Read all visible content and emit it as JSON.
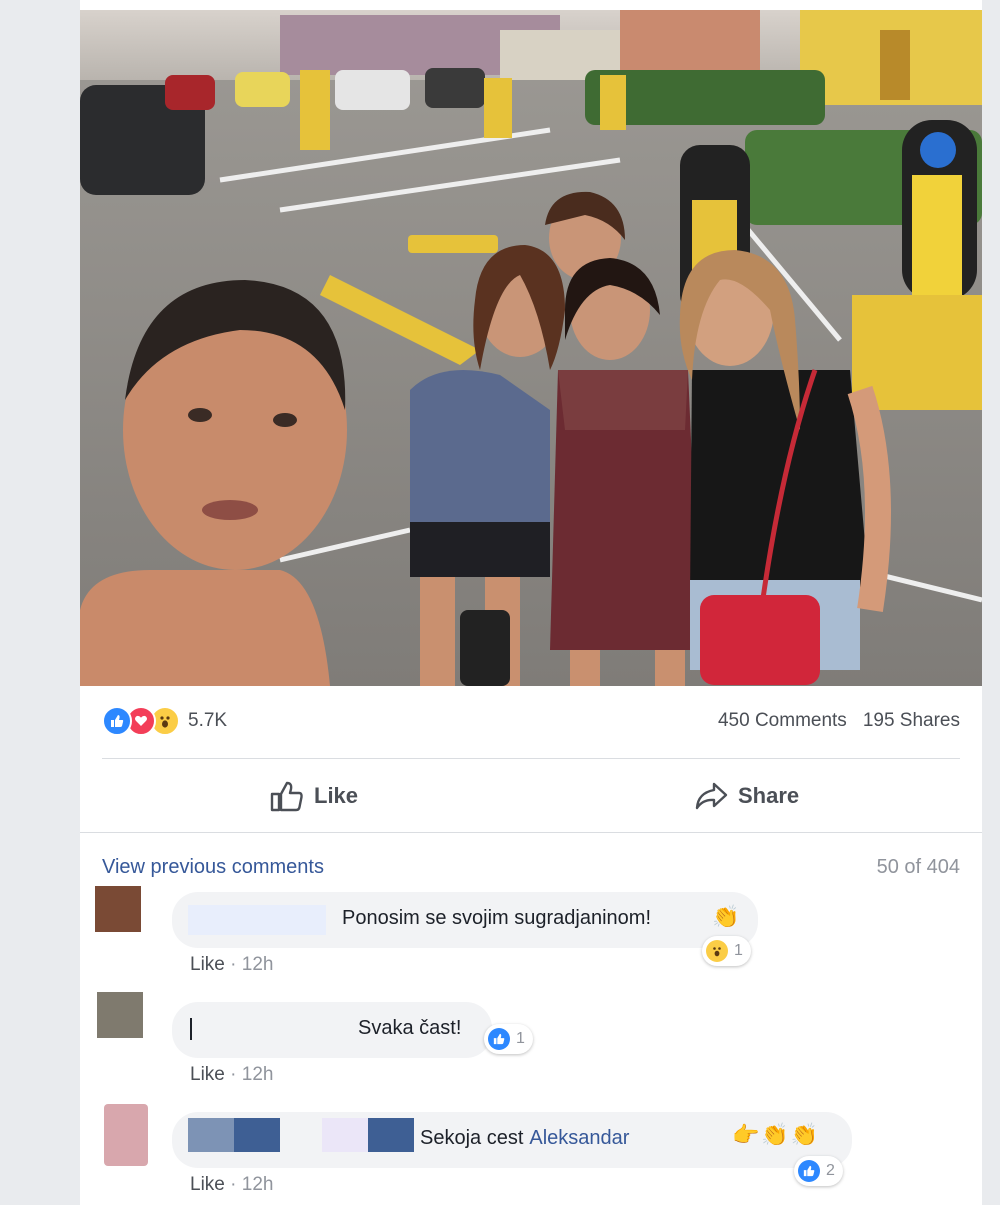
{
  "post": {
    "reaction_count": "5.7K",
    "comments_count": "450 Comments",
    "shares_count": "195 Shares",
    "reaction_icons": [
      "like-icon",
      "love-icon",
      "wow-icon"
    ]
  },
  "actions": {
    "like_label": "Like",
    "share_label": "Share"
  },
  "comments_section": {
    "view_previous": "View previous comments",
    "page_count": "50 of 404",
    "comments": [
      {
        "text": "Ponosim se svojim sugradjaninom!",
        "emoji": "clapping-hands",
        "reaction_icon": "wow-icon",
        "reaction_count": "1",
        "like_label": "Like",
        "sep": " · ",
        "time": "12h"
      },
      {
        "text": "Svaka čast!",
        "reaction_icon": "like-icon",
        "reaction_count": "1",
        "like_label": "Like",
        "sep": " · ",
        "time": "12h"
      },
      {
        "text": "Sekoja cest",
        "mention": "Aleksandar",
        "emoji": "pointing-hand clapping-hands clapping-hands",
        "reaction_icon": "like-icon",
        "reaction_count": "2",
        "like_label": "Like",
        "sep": " · ",
        "time": "12h"
      }
    ]
  },
  "colors": {
    "link_blue": "#365899",
    "like_blue": "#2d88ff",
    "love_red": "#f33e58",
    "wow_yellow": "#fbcd46",
    "bubble_gray": "#f2f3f5"
  }
}
